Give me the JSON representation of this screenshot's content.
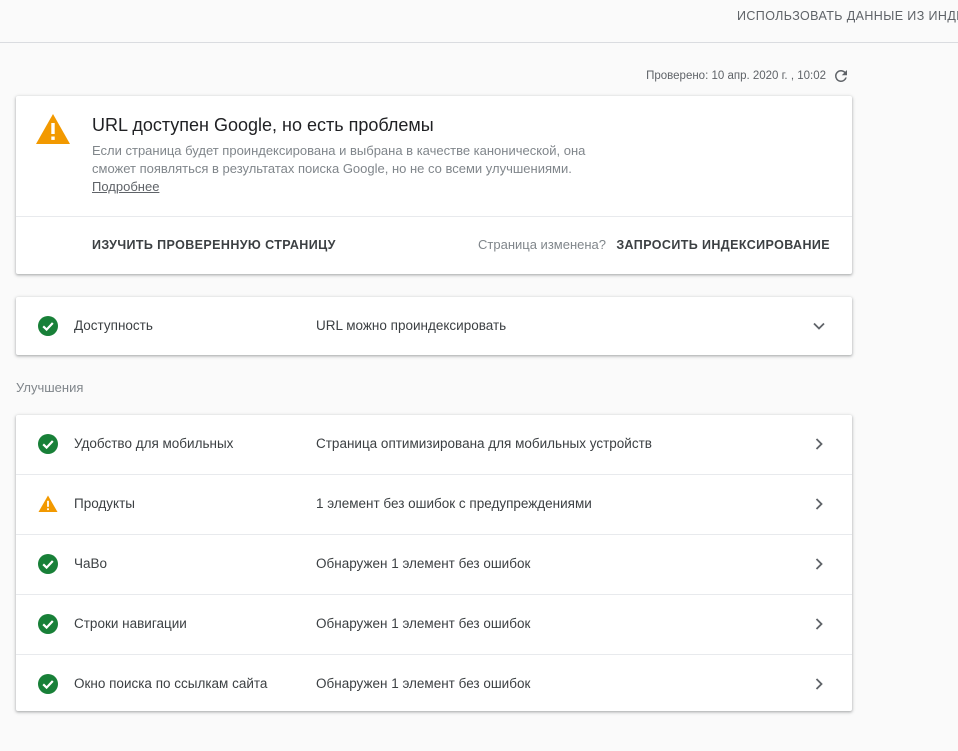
{
  "topbar": {
    "action_label": "ИСПОЛЬЗОВАТЬ ДАННЫЕ ИЗ ИНДЕКСА"
  },
  "checked": {
    "text": "Проверено: 10 апр. 2020 г. , 10:02",
    "refresh_icon": "refresh-icon"
  },
  "status": {
    "title": "URL доступен Google, но есть проблемы",
    "description": "Если страница будет проиндексирована и выбрана в качестве канонической, она сможет появляться в результатах поиска Google, но не со всеми улучшениями. ",
    "more_link": "Подробнее",
    "inspect_label": "ИЗУЧИТЬ ПРОВЕРЕННУЮ СТРАНИЦУ",
    "changed_question": "Страница изменена?",
    "request_label": "ЗАПРОСИТЬ ИНДЕКСИРОВАНИЕ",
    "icon": "warning-icon",
    "colors": {
      "warning": "#f29900",
      "ok": "#188038"
    }
  },
  "coverage": {
    "name": "Доступность",
    "value": "URL можно проиндексировать",
    "icon": "check-circle-icon",
    "chevron": "chevron-down-icon"
  },
  "enhancements": {
    "section_label": "Улучшения",
    "items": [
      {
        "name": "Удобство для мобильных",
        "value": "Страница оптимизирована для мобильных устройств",
        "status": "ok"
      },
      {
        "name": "Продукты",
        "value": "1 элемент без ошибок с предупреждениями",
        "status": "warning"
      },
      {
        "name": "ЧаВо",
        "value": "Обнаружен 1 элемент без ошибок",
        "status": "ok"
      },
      {
        "name": "Строки навигации",
        "value": "Обнаружен 1 элемент без ошибок",
        "status": "ok"
      },
      {
        "name": "Окно поиска по ссылкам сайта",
        "value": "Обнаружен 1 элемент без ошибок",
        "status": "ok"
      }
    ]
  }
}
